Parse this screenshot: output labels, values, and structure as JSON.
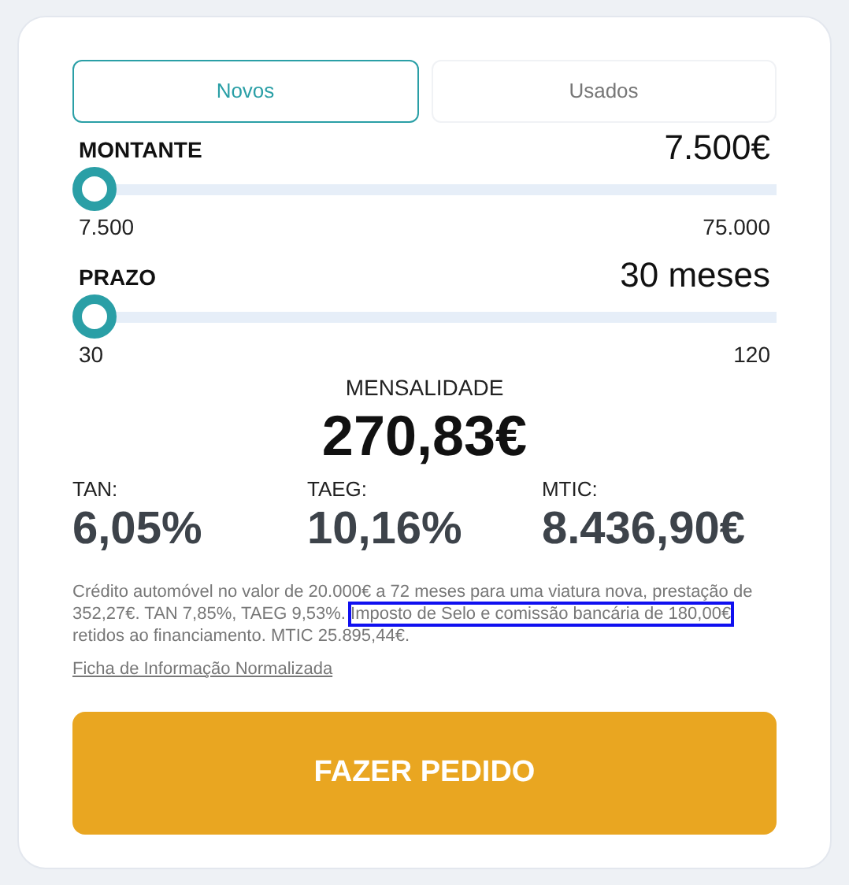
{
  "tabs": [
    {
      "label": "Novos",
      "selected": true
    },
    {
      "label": "Usados",
      "selected": false
    }
  ],
  "sliders": [
    {
      "label": "MONTANTE",
      "value": "7.500€",
      "level": 0,
      "min": "7.500",
      "max": "75.000"
    },
    {
      "label": "PRAZO",
      "value": "30 meses",
      "level": 0,
      "min": "30",
      "max": "120"
    }
  ],
  "monthly": {
    "label": "MENSALIDADE",
    "value": "270,83€"
  },
  "rates": [
    {
      "label": "TAN:",
      "value": "6,05%"
    },
    {
      "label": "TAEG:",
      "value": "10,16%"
    },
    {
      "label": "MTIC:",
      "value": "8.436,90€"
    }
  ],
  "disclaimer": [
    {
      "text": "Crédito automóvel no valor de 20.000€ a 72 meses para uma viatura nova, prestação de 352,27€. TAN 7,85%, TAEG 9,53%. ",
      "highlighted": false
    },
    {
      "text": "Imposto de Selo e comissão bancária de 180,00€",
      "highlighted": true
    },
    {
      "text": " retidos ao financiamento. MTIC 25.895,44€.",
      "highlighted": false
    }
  ],
  "link": "Ficha de Informação Normalizada",
  "submit": "FAZER PEDIDO"
}
